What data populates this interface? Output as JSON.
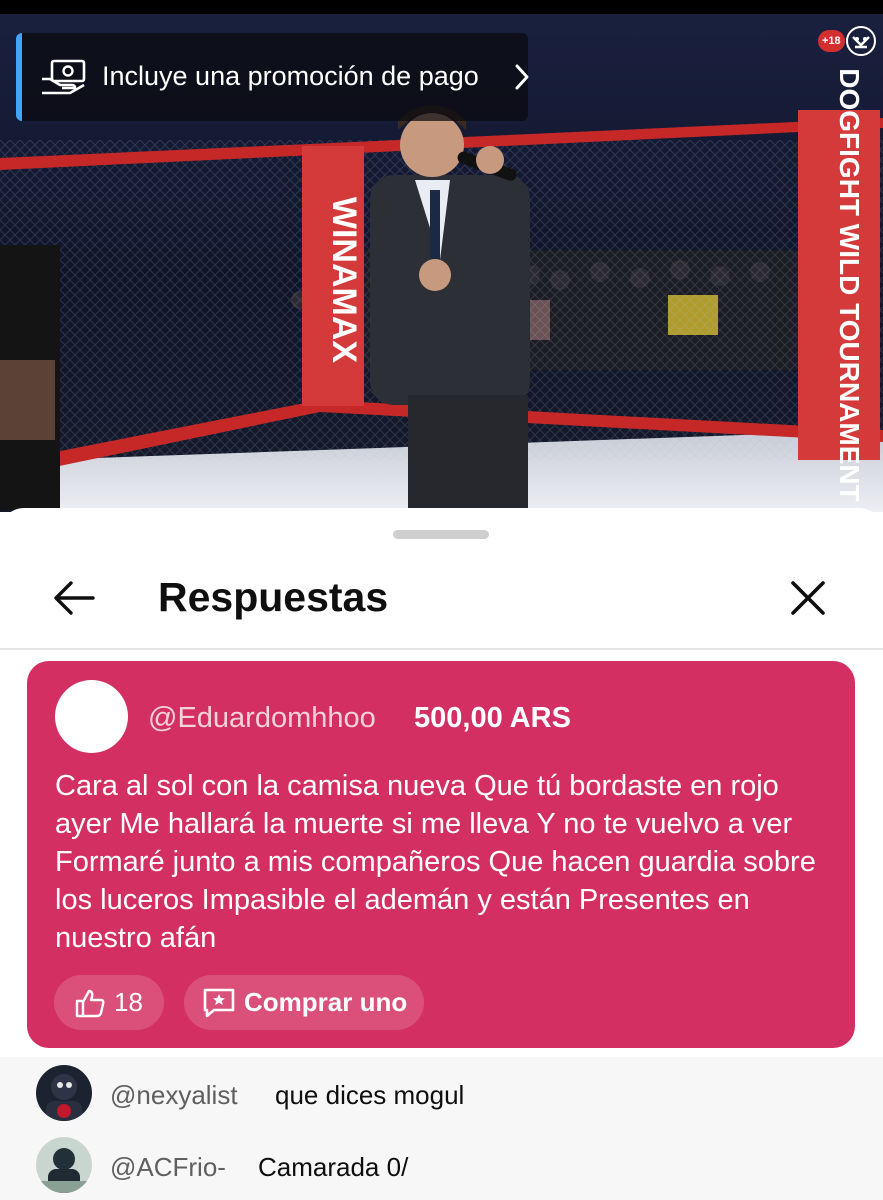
{
  "video": {
    "promo_label": "Incluye una promoción de pago",
    "promo_icon": "money-hand-icon",
    "age_rating": "+18",
    "cage_left_banner": "WINAMAX",
    "cage_right_banner": "DOGFIGHT WILD TOURNAMENT"
  },
  "header": {
    "title": "Respuestas",
    "back_icon": "arrow-left-icon",
    "close_icon": "close-icon"
  },
  "super_chat": {
    "username": "@Eduardomhhoo",
    "amount": "500,00 ARS",
    "message": "Cara al sol con la camisa nueva Que tú bordaste en rojo ayer Me hallará la muerte si me lleva Y no te vuelvo a ver Formaré junto a mis compañeros Que hacen guardia sobre los luceros Impasible el ademán y están Presentes en nuestro afán",
    "like_count": "18",
    "buy_label": "Comprar uno",
    "color": "#d32f62"
  },
  "replies": [
    {
      "username": "@nexyalist",
      "text": "que dices mogul"
    },
    {
      "username": "@ACFrio-",
      "text": "Camarada 0/"
    }
  ]
}
